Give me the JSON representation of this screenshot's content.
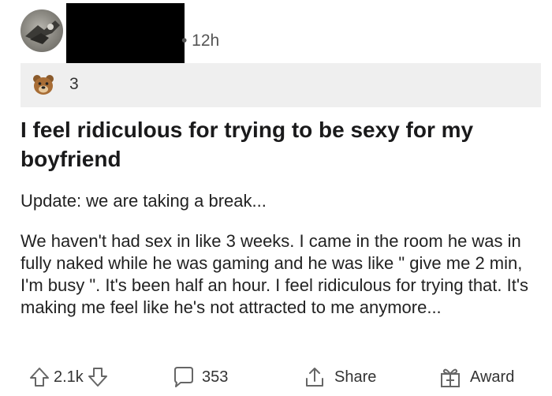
{
  "post": {
    "time": "• 12h",
    "flair_count": "3",
    "title": "I feel ridiculous for trying to be sexy for my boyfriend",
    "update": "Update: we are taking a break...",
    "body": "We haven't had sex in like 3 weeks. I came in the room he was in fully naked while he was gaming and he was like \" give me 2 min, I'm busy \". It's been half an hour. I feel ridiculous for trying that. It's making me feel like he's not attracted to me anymore..."
  },
  "actions": {
    "votes": "2.1k",
    "comments": "353",
    "share": "Share",
    "award": "Award"
  },
  "colors": {
    "flair_bg": "#efefef",
    "text": "#1c1c1c",
    "icon": "#666666"
  }
}
